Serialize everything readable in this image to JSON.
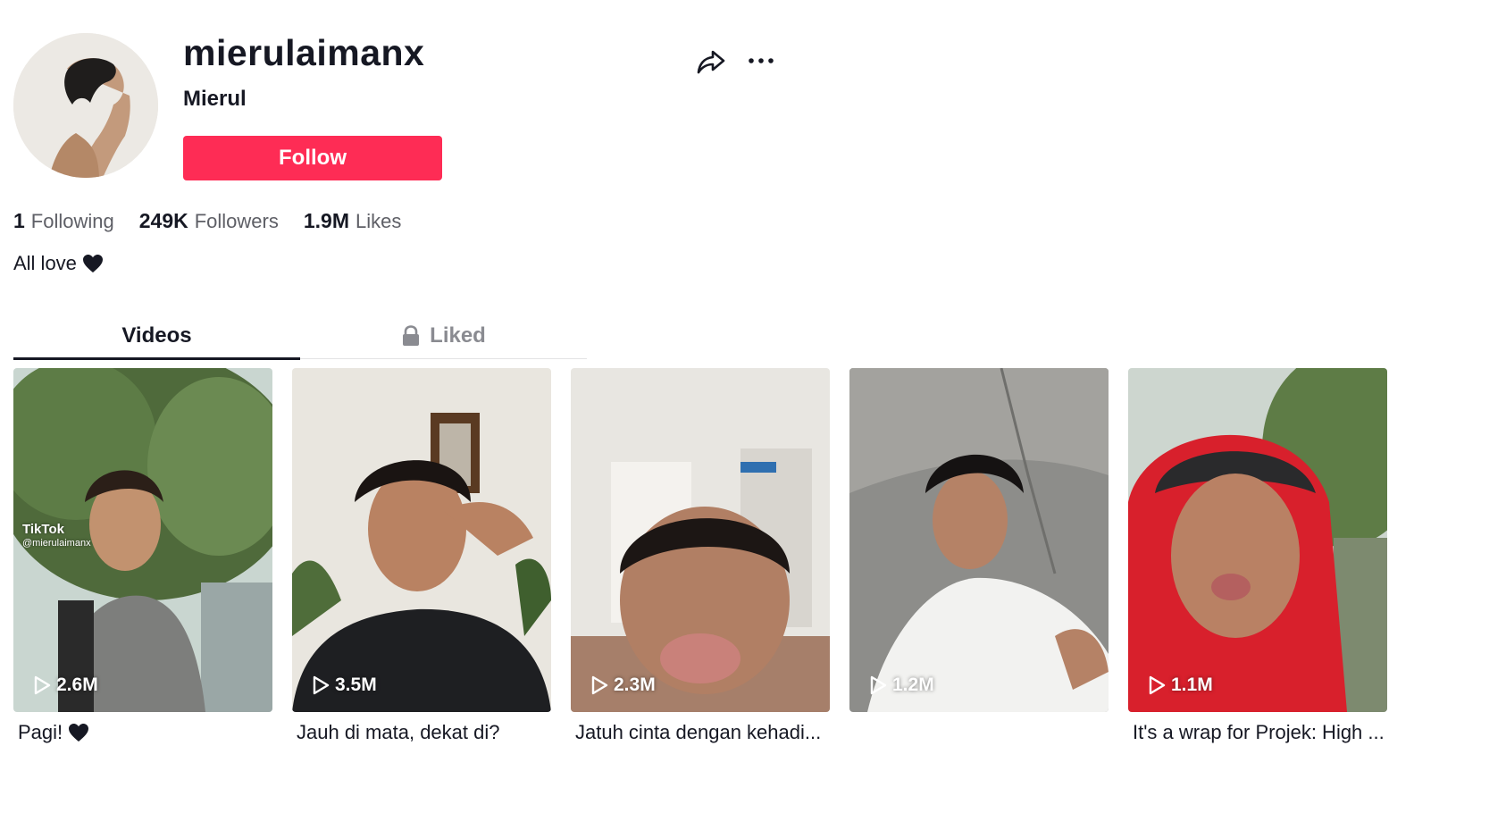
{
  "profile": {
    "username": "mierulaimanx",
    "nickname": "Mierul",
    "follow_label": "Follow",
    "bio": "All love",
    "avatar_icon": "avatar-photo"
  },
  "actions": {
    "share_icon": "share-icon",
    "more_icon": "more-icon"
  },
  "stats": [
    {
      "count": "1",
      "label": "Following"
    },
    {
      "count": "249K",
      "label": "Followers"
    },
    {
      "count": "1.9M",
      "label": "Likes"
    }
  ],
  "tabs": [
    {
      "label": "Videos",
      "active": true
    },
    {
      "label": "Liked",
      "active": false,
      "locked": true
    }
  ],
  "videos": [
    {
      "views": "2.6M",
      "caption": "Pagi!",
      "watermark": "TikTok",
      "watermark_handle": "@mierulaimanx"
    },
    {
      "views": "3.5M",
      "caption": "Jauh di mata, dekat di?"
    },
    {
      "views": "2.3M",
      "caption": "Jatuh cinta dengan kehadi..."
    },
    {
      "views": "1.2M",
      "caption": ""
    },
    {
      "views": "1.1M",
      "caption": "It's a wrap for Projek: High ..."
    }
  ],
  "colors": {
    "accent": "#fe2c55",
    "text": "#161823",
    "muted": "#5e5f66"
  }
}
